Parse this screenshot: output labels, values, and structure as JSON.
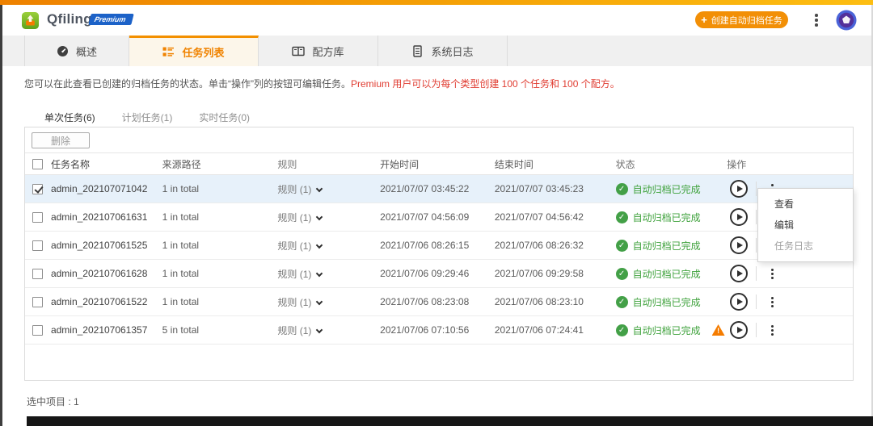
{
  "header": {
    "app_name": "Qfiling",
    "premium_badge": "Premium",
    "create_button_plus": "+",
    "create_button_label": "创建自动归档任务"
  },
  "tabs": [
    {
      "label": "概述",
      "icon": "gauge-icon",
      "active": false
    },
    {
      "label": "任务列表",
      "icon": "task-list-icon",
      "active": true
    },
    {
      "label": "配方库",
      "icon": "recipe-book-icon",
      "active": false
    },
    {
      "label": "系统日志",
      "icon": "log-document-icon",
      "active": false
    }
  ],
  "intro": {
    "text_main": "您可以在此查看已创建的归档任务的状态。单击“操作”列的按钮可编辑任务。",
    "text_premium": "Premium 用户可以为每个类型创建 100 个任务和 100 个配方。"
  },
  "subtabs": [
    {
      "label": "单次任务(6)",
      "active": true
    },
    {
      "label": "计划任务(1)",
      "active": false
    },
    {
      "label": "实时任务(0)",
      "active": false
    }
  ],
  "toolbar": {
    "delete_label": "删除"
  },
  "table": {
    "headers": [
      "任务名称",
      "来源路径",
      "规则",
      "开始时间",
      "结束时间",
      "状态",
      "操作"
    ],
    "rows": [
      {
        "checked": true,
        "highlighted": true,
        "name": "admin_202107071042",
        "path": "1 in total",
        "rule": "规则 (1)",
        "start": "2021/07/07 03:45:22",
        "end": "2021/07/07 03:45:23",
        "status": "自动归档已完成",
        "warning": false
      },
      {
        "checked": false,
        "highlighted": false,
        "name": "admin_202107061631",
        "path": "1 in total",
        "rule": "规则 (1)",
        "start": "2021/07/07 04:56:09",
        "end": "2021/07/07 04:56:42",
        "status": "自动归档已完成",
        "warning": false
      },
      {
        "checked": false,
        "highlighted": false,
        "name": "admin_202107061525",
        "path": "1 in total",
        "rule": "规则 (1)",
        "start": "2021/07/06 08:26:15",
        "end": "2021/07/06 08:26:32",
        "status": "自动归档已完成",
        "warning": false
      },
      {
        "checked": false,
        "highlighted": false,
        "name": "admin_202107061628",
        "path": "1 in total",
        "rule": "规则 (1)",
        "start": "2021/07/06 09:29:46",
        "end": "2021/07/06 09:29:58",
        "status": "自动归档已完成",
        "warning": false
      },
      {
        "checked": false,
        "highlighted": false,
        "name": "admin_202107061522",
        "path": "1 in total",
        "rule": "规则 (1)",
        "start": "2021/07/06 08:23:08",
        "end": "2021/07/06 08:23:10",
        "status": "自动归档已完成",
        "warning": false
      },
      {
        "checked": false,
        "highlighted": false,
        "name": "admin_202107061357",
        "path": "5 in total",
        "rule": "规则 (1)",
        "start": "2021/07/06 07:10:56",
        "end": "2021/07/06 07:24:41",
        "status": "自动归档已完成",
        "warning": true
      }
    ],
    "status_warning_mark": "!",
    "status_check_mark": "✓"
  },
  "context_menu": {
    "items": [
      {
        "label": "查看"
      },
      {
        "label": "编辑"
      },
      {
        "label": "任务日志"
      }
    ]
  },
  "footer": {
    "selection_label": "选中项目 : 1"
  },
  "icons": {
    "app_logo": "qfiling-logo-icon",
    "header_more": "kebab-menu-icon",
    "user": "avatar-icon",
    "row_play": "play-icon",
    "row_more": "kebab-menu-icon",
    "status_ok": "check-circle-icon",
    "status_warning": "warning-triangle-icon"
  },
  "colors": {
    "accent_orange": "#F28C00",
    "topbar_gradient_left": "#EE8100",
    "topbar_gradient_right": "#FDBE12",
    "status_green": "#43A047",
    "warning_orange": "#F57C00",
    "premium_text_red": "#E03C31",
    "badge_blue": "#1C62C8",
    "row_highlight_blue": "#E7F1FA"
  }
}
